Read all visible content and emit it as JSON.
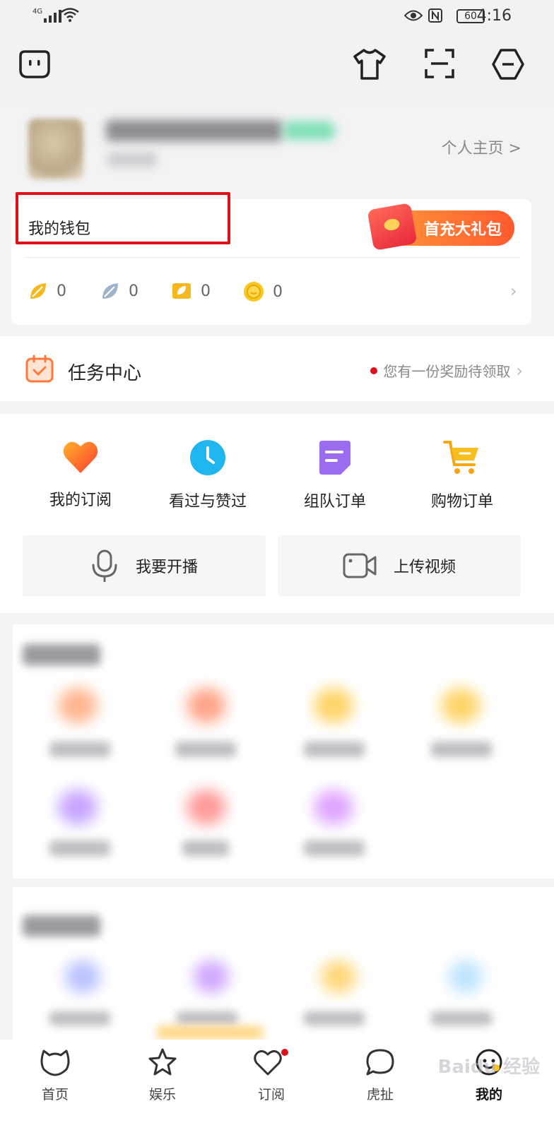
{
  "status_bar": {
    "network": "4G",
    "battery": "60",
    "time": "4:16"
  },
  "header": {
    "icons": [
      "message-icon",
      "outfit-icon",
      "scan-icon",
      "settings-icon"
    ]
  },
  "profile": {
    "homepage_link": "个人主页 >"
  },
  "wallet": {
    "title": "我的钱包",
    "gift_button": "首充大礼包",
    "assets": [
      {
        "icon": "gold-bean-icon",
        "color": "#f5b81e",
        "value": "0"
      },
      {
        "icon": "silver-bean-icon",
        "color": "#9fb4cc",
        "value": "0"
      },
      {
        "icon": "coupon-icon",
        "color": "#f5b81e",
        "value": "0"
      },
      {
        "icon": "coin-icon",
        "color": "#f8c81c",
        "value": "0"
      }
    ]
  },
  "task_center": {
    "title": "任务中心",
    "hint": "您有一份奖励待领取"
  },
  "features": [
    {
      "icon": "heart-icon",
      "label": "我的订阅"
    },
    {
      "icon": "clock-icon",
      "label": "看过与赞过"
    },
    {
      "icon": "note-icon",
      "label": "组队订单"
    },
    {
      "icon": "cart-icon",
      "label": "购物订单"
    }
  ],
  "actions": [
    {
      "icon": "microphone-icon",
      "label": "我要开播"
    },
    {
      "icon": "video-camera-icon",
      "label": "上传视频"
    }
  ],
  "tabbar": [
    {
      "icon": "home-icon",
      "label": "首页"
    },
    {
      "icon": "star-icon",
      "label": "娱乐"
    },
    {
      "icon": "heart-tab-icon",
      "label": "订阅"
    },
    {
      "icon": "chat-icon",
      "label": "虎扯"
    },
    {
      "icon": "me-icon",
      "label": "我的"
    }
  ],
  "colors": {
    "accent": "#ff7a3a",
    "highlight_box": "#e0101a",
    "red_dot": "#e0101a"
  },
  "watermark": "Baidu 经验"
}
